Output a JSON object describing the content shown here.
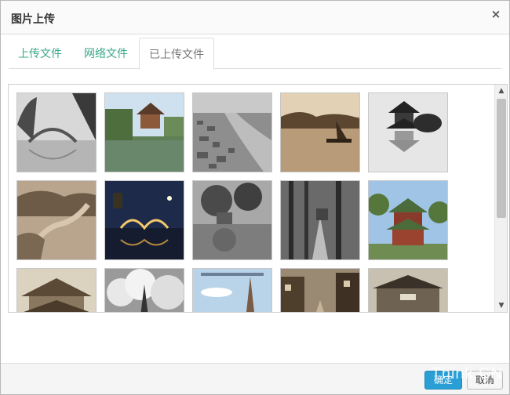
{
  "dialog": {
    "title": "图片上传",
    "close_label": "×"
  },
  "tabs": [
    {
      "label": "上传文件",
      "active": false
    },
    {
      "label": "网络文件",
      "active": false
    },
    {
      "label": "已上传文件",
      "active": true
    }
  ],
  "images": [
    {
      "name": "arched-bridge-photo"
    },
    {
      "name": "pavilion-lake-photo"
    },
    {
      "name": "aerial-river-city-photo"
    },
    {
      "name": "sepia-boat-photo"
    },
    {
      "name": "pagoda-reflection-photo"
    },
    {
      "name": "great-wall-photo"
    },
    {
      "name": "night-bridge-photo"
    },
    {
      "name": "trees-pond-photo"
    },
    {
      "name": "forest-path-photo"
    },
    {
      "name": "temple-pavilion-photo"
    },
    {
      "name": "old-roof-photo"
    },
    {
      "name": "cloudy-spire-photo"
    },
    {
      "name": "church-spire-postcard-photo"
    },
    {
      "name": "old-street-photo"
    },
    {
      "name": "city-gate-photo"
    }
  ],
  "scrollbar": {
    "up": "▲",
    "down": "▼"
  },
  "footer": {
    "ok_label": "确定",
    "cancel_label": "取消"
  },
  "watermark": "Think.CN"
}
